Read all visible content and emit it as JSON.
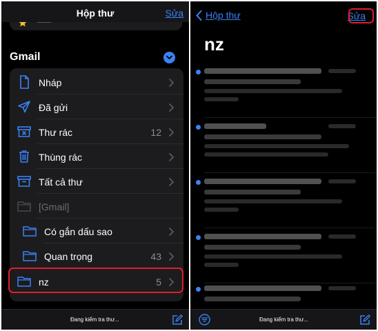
{
  "left_panel": {
    "header_title": "Hộp thư",
    "edit_label": "Sửa",
    "section_title": "Gmail",
    "items": [
      {
        "label": "Nháp",
        "count": "",
        "icon": "draft-icon"
      },
      {
        "label": "Đã gửi",
        "count": "",
        "icon": "sent-icon"
      },
      {
        "label": "Thư rác",
        "count": "12",
        "icon": "junk-icon"
      },
      {
        "label": "Thùng rác",
        "count": "",
        "icon": "trash-icon"
      },
      {
        "label": "Tất cả thư",
        "count": "",
        "icon": "archive-icon"
      },
      {
        "label": "[Gmail]",
        "count": "",
        "icon": "folder-icon"
      },
      {
        "label": "Có gắn dấu sao",
        "count": "",
        "icon": "folder-icon"
      },
      {
        "label": "Quan trọng",
        "count": "43",
        "icon": "folder-icon"
      },
      {
        "label": "nz",
        "count": "5",
        "icon": "folder-icon"
      }
    ],
    "status_text": "Đang kiểm tra thư..."
  },
  "right_panel": {
    "back_label": "Hộp thư",
    "edit_label": "Sửa",
    "folder_title": "nz",
    "messages_count_visible": 5,
    "status_text": "Đang kiểm tra thư..."
  },
  "colors": {
    "accent": "#3b82f6",
    "highlight": "#e01e2d",
    "background": "#000000",
    "group_background": "#1c1c1e"
  }
}
